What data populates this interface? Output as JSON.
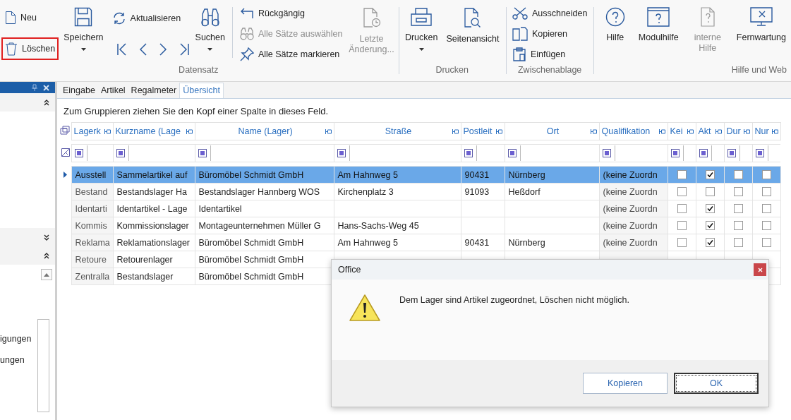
{
  "ribbon": {
    "datensatz": {
      "label": "Datensatz",
      "neu": {
        "label": "Neu"
      },
      "loeschen": {
        "label": "Löschen",
        "highlighted": true
      },
      "speichern": {
        "label": "Speichern"
      },
      "aktualisieren": {
        "label": "Aktualisieren"
      },
      "suchen": {
        "label": "Suchen"
      },
      "rueckgaengig": {
        "label": "Rückgängig"
      },
      "alle_auswaehlen": {
        "label": "Alle Sätze auswählen",
        "disabled": true
      },
      "alle_markieren": {
        "label": "Alle Sätze markieren"
      },
      "letzte_aenderung": {
        "label": "Letzte Änderung...",
        "disabled": true
      }
    },
    "drucken": {
      "label": "Drucken",
      "drucken": {
        "label": "Drucken"
      },
      "seitenansicht": {
        "label": "Seitenansicht"
      }
    },
    "zwischenablage": {
      "label": "Zwischenablage",
      "ausschneiden": {
        "label": "Ausschneiden"
      },
      "kopieren": {
        "label": "Kopieren"
      },
      "einfuegen": {
        "label": "Einfügen"
      }
    },
    "hilfe": {
      "label": "Hilfe und Web",
      "hilfe": {
        "label": "Hilfe"
      },
      "modulhilfe": {
        "label": "Modulhilfe"
      },
      "interne_hilfe": {
        "label": "interne Hilfe",
        "disabled": true
      },
      "fernwartung": {
        "label": "Fernwartung"
      }
    }
  },
  "left_panel": {
    "items": [
      "igungen",
      "ungen"
    ]
  },
  "tabs": [
    {
      "label": "Eingabe",
      "selected": false
    },
    {
      "label": "Artikel",
      "selected": false
    },
    {
      "label": "Regalmeter",
      "selected": false
    },
    {
      "label": "Übersicht",
      "selected": true
    }
  ],
  "group_panel": {
    "text": "Zum Gruppieren ziehen Sie den Kopf einer Spalte in dieses Feld."
  },
  "table": {
    "columns": [
      "Lagerk",
      "Kurzname (Lage",
      "Name (Lager)",
      "Straße",
      "Postleit",
      "Ort",
      "Qualifikation",
      "Kei",
      "Akt",
      "Dur",
      "Nur"
    ],
    "rows": [
      {
        "selected": true,
        "cells": [
          "Ausstell",
          "Sammelartikel auf",
          "Büromöbel Schmidt GmbH",
          "Am Hahnweg 5",
          "90431",
          "Nürnberg",
          "(keine Zuordn"
        ],
        "checks": [
          false,
          true,
          false,
          false
        ]
      },
      {
        "selected": false,
        "cells": [
          "Bestand",
          "Bestandslager Ha",
          "Bestandslager Hannberg WOS",
          "Kirchenplatz 3",
          "91093",
          "Heßdorf",
          "(keine Zuordn"
        ],
        "checks": [
          false,
          false,
          false,
          false
        ]
      },
      {
        "selected": false,
        "cells": [
          "Identarti",
          "Identartikel - Lage",
          "Identartikel",
          "",
          "",
          "",
          "(keine Zuordn"
        ],
        "checks": [
          false,
          true,
          false,
          false
        ]
      },
      {
        "selected": false,
        "cells": [
          "Kommis",
          "Kommissionslager",
          "Montageunternehmen Müller G",
          "Hans-Sachs-Weg 45",
          "",
          "",
          "(keine Zuordn"
        ],
        "checks": [
          false,
          true,
          false,
          false
        ]
      },
      {
        "selected": false,
        "cells": [
          "Reklama",
          "Reklamationslager",
          "Büromöbel Schmidt GmbH",
          "Am Hahnweg 5",
          "90431",
          "Nürnberg",
          "(keine Zuordn"
        ],
        "checks": [
          false,
          true,
          false,
          false
        ]
      },
      {
        "selected": false,
        "cells": [
          "Retoure",
          "Retourenlager",
          "Büromöbel Schmidt GmbH"
        ]
      },
      {
        "selected": false,
        "cells": [
          "Zentralla",
          "Bestandslager",
          "Büromöbel Schmidt GmbH"
        ]
      }
    ]
  },
  "dialog": {
    "title": "Office",
    "message": "Dem Lager sind Artikel zugeordnet, Löschen nicht möglich.",
    "buttons": [
      {
        "label": "Kopieren",
        "focused": false
      },
      {
        "label": "OK",
        "focused": true
      }
    ]
  }
}
